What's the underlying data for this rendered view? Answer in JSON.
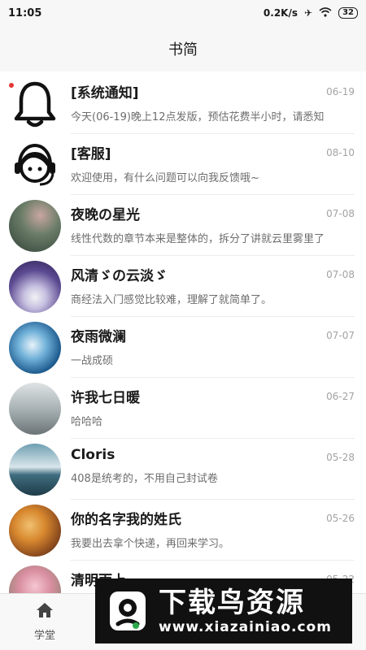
{
  "status_bar": {
    "time": "11:05",
    "speed": "0.2K/s",
    "battery": "32"
  },
  "header": {
    "title": "书简"
  },
  "messages": [
    {
      "title": "[系统通知]",
      "date": "06-19",
      "preview": "今天(06-19)晚上12点发版，预估花费半小时，请悉知",
      "icon": "bell-icon",
      "unread": true
    },
    {
      "title": "[客服]",
      "date": "08-10",
      "preview": "欢迎使用，有什么问题可以向我反馈哦~",
      "icon": "customer-service-icon"
    },
    {
      "title": "夜晚の星光",
      "date": "07-08",
      "preview": "线性代数的章节本来是整体的，拆分了讲就云里雾里了",
      "color": "#3e5a4a"
    },
    {
      "title": "风清ゞの云淡ゞ",
      "date": "07-08",
      "preview": "商经法入门感觉比较难，理解了就简单了。",
      "color": "#4b3f7a"
    },
    {
      "title": "夜雨微澜",
      "date": "07-07",
      "preview": "一战成硕",
      "color": "#2f74a6"
    },
    {
      "title": "许我七日暖",
      "date": "06-27",
      "preview": "哈哈哈",
      "color": "#9aa4a8"
    },
    {
      "title": "Cloris",
      "date": "05-28",
      "preview": "408是统考的，不用自己封试卷",
      "color": "#3f6d80"
    },
    {
      "title": "你的名字我的姓氏",
      "date": "05-26",
      "preview": "我要出去拿个快递，再回来学习。",
      "color": "#c9762e"
    },
    {
      "title": "清明雨上",
      "date": "05-22",
      "preview": "",
      "color": "#c98a9a"
    }
  ],
  "tabbar": {
    "home_label": "学堂"
  },
  "watermark": {
    "title": "下载鸟资源",
    "url": "www.xiazainiao.com"
  }
}
